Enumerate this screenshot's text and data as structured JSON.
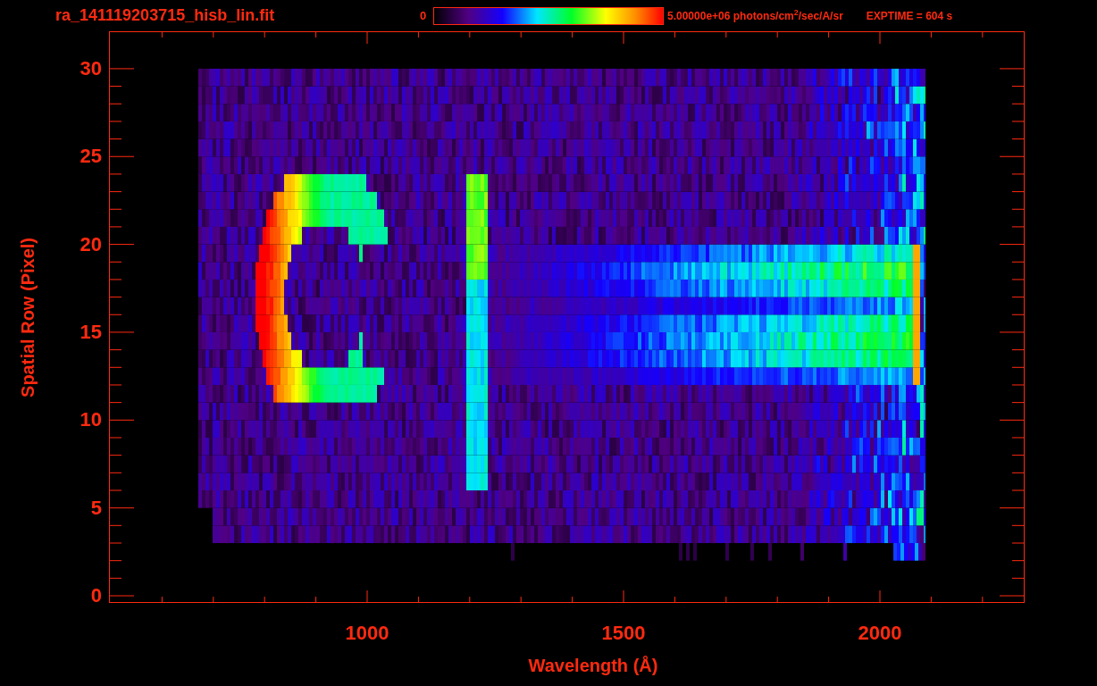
{
  "title": "ra_141119203715_hisb_lin.fit",
  "colorbar": {
    "min_label": "0",
    "max_label": "5.00000e+06 photons/cm$^{2}$/sec/A/sr"
  },
  "exptime": "EXPTIME = 604 s",
  "plot": {
    "xlabel": "Wavelength (Å)",
    "ylabel": "Spatial Row (Pixel)",
    "xticks": [
      "1000",
      "1500",
      "2000"
    ],
    "yticks": [
      "30",
      "25",
      "20",
      "15",
      "10",
      "5",
      "0"
    ]
  }
}
